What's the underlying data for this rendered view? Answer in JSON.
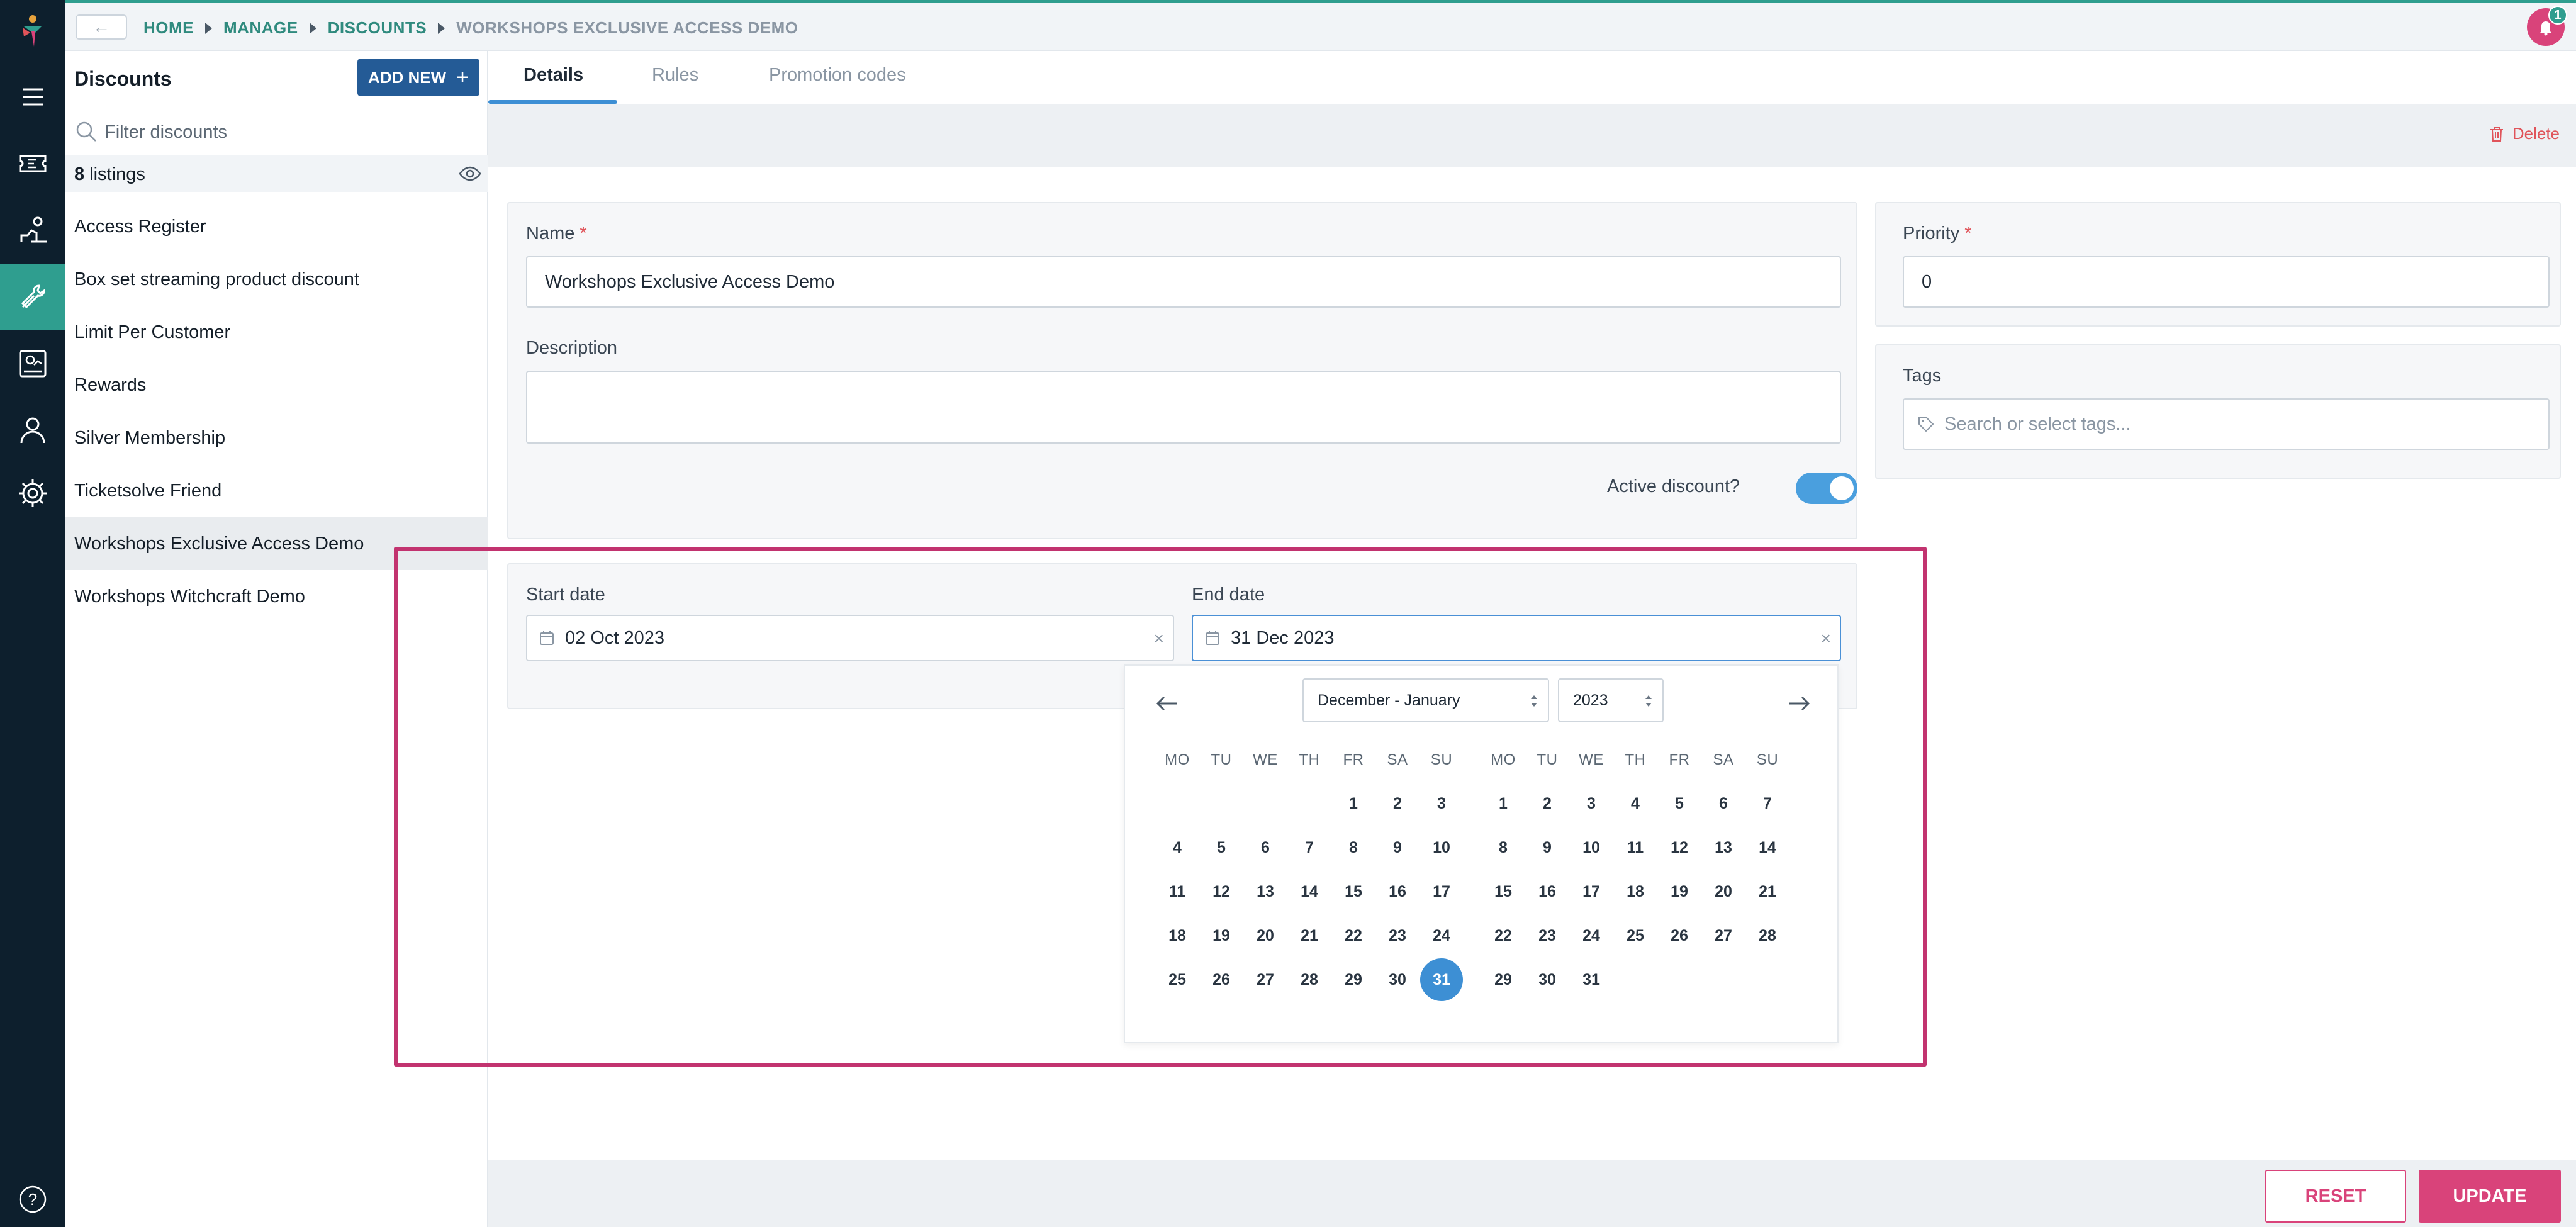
{
  "breadcrumb": {
    "back_label": "←",
    "items": [
      "HOME",
      "MANAGE",
      "DISCOUNTS",
      "WORKSHOPS EXCLUSIVE ACCESS DEMO"
    ]
  },
  "notifications": {
    "count": "1"
  },
  "sidebar": {
    "icons": [
      "menu-icon",
      "ticket-icon",
      "users-group-icon",
      "tools-icon",
      "reports-icon",
      "person-icon",
      "gear-icon",
      "help-icon"
    ],
    "active": "tools-icon",
    "help_label": "?"
  },
  "list": {
    "title": "Discounts",
    "add_new_label": "ADD NEW",
    "filter_placeholder": "Filter discounts",
    "listings_count": "8",
    "listings_label": "listings",
    "items": [
      "Access Register",
      "Box set streaming product discount",
      "Limit Per Customer",
      "Rewards",
      "Silver Membership",
      "Ticketsolve Friend",
      "Workshops Exclusive Access Demo",
      "Workshops Witchcraft Demo"
    ],
    "selected_index": 6
  },
  "tabs": [
    "Details",
    "Rules",
    "Promotion codes"
  ],
  "actions": {
    "delete_label": "Delete"
  },
  "form": {
    "name_label": "Name",
    "name_value": "Workshops Exclusive Access Demo",
    "required_mark": "*",
    "description_label": "Description",
    "description_value": "",
    "active_label": "Active discount?",
    "active_value": true,
    "priority_label": "Priority",
    "priority_value": "0",
    "tags_label": "Tags",
    "tags_placeholder": "Search or select tags...",
    "start_label": "Start date",
    "start_value": "02 Oct 2023",
    "end_label": "End date",
    "end_value": "31 Dec 2023",
    "clear_glyph": "×"
  },
  "calendar": {
    "month_select": "December - January",
    "year_select": "2023",
    "weekdays": [
      "MO",
      "TU",
      "WE",
      "TH",
      "FR",
      "SA",
      "SU"
    ],
    "month1_first_weekday_index": 4,
    "month1_days": 31,
    "month2_first_weekday_index": 0,
    "month2_days": 31,
    "selected": {
      "month": 1,
      "day": 31
    }
  },
  "footer": {
    "reset_label": "RESET",
    "update_label": "UPDATE"
  },
  "colors": {
    "accent": "#2f9e8f",
    "primary": "#245b96",
    "brand_pink": "#d9437a",
    "focus_blue": "#3d8fd4",
    "danger": "#e0545a"
  }
}
